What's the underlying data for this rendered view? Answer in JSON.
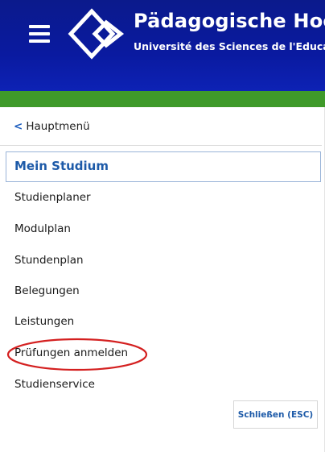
{
  "header": {
    "title": "Pädagogische Hochs",
    "subtitle": "Université des Sciences de l'Educatio",
    "menu_icon": "hamburger-menu-icon",
    "logo_icon": "diamond-logo-icon",
    "background_color": "#0b1a8c",
    "accent_bar_color": "#3f9a2a"
  },
  "nav": {
    "back_label": "Hauptmenü",
    "back_icon": "chevron-left-icon",
    "active_item": "Mein Studium",
    "items": [
      "Studienplaner",
      "Modulplan",
      "Stundenplan",
      "Belegungen",
      "Leistungen",
      "Prüfungen anmelden",
      "Studienservice"
    ],
    "highlighted_item_color": "#d42020"
  },
  "close_button": {
    "label": "Schließen (ESC)"
  }
}
